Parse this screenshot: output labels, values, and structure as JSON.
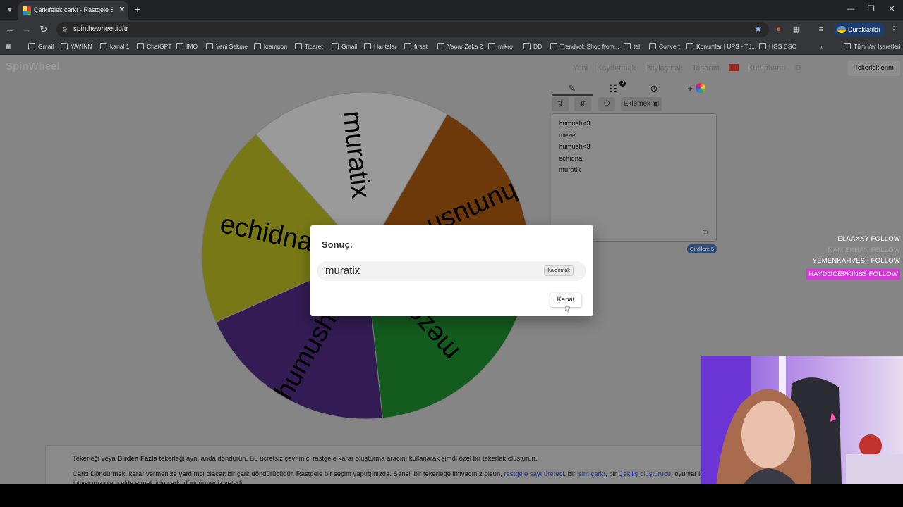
{
  "browser": {
    "tab_title": "Çarkıfelek çarkı - Rastgele Seçe",
    "url": "spinthewheel.io/tr",
    "profile_label": "Duraklatıldı",
    "bookmarks": [
      "Gmail",
      "YAYINN",
      "kanal 1",
      "ChatGPT",
      "IMO",
      "Yeni Sekme",
      "krampon",
      "Ticaret",
      "Gmail",
      "Haritalar",
      "fırsat",
      "Yapar Zeka 2",
      "mikro",
      "DD",
      "Trendyol: Shop from...",
      "tel",
      "Convert",
      "Konumlar | UPS - Tü...",
      "HGS CSC"
    ],
    "all_bookmarks": "Tüm Yer İşaretleri"
  },
  "site": {
    "logo": "SpinWheel",
    "nav": [
      "Yeni",
      "Kaydetmek",
      "Paylaşmak",
      "Tasarım",
      "Kütüphane"
    ],
    "my_wheels": "Tekerleklerim"
  },
  "wheel": {
    "segments": [
      {
        "label": "humush<3",
        "color": "#a6560f"
      },
      {
        "label": "meze",
        "color": "#1e8a2e"
      },
      {
        "label": "humush<3",
        "color": "#4b2a7d"
      },
      {
        "label": "echidna",
        "color": "#b6b821"
      },
      {
        "label": "muratix",
        "color": "#e9e9e9"
      }
    ]
  },
  "editor": {
    "add_label": "Eklemek",
    "badge_count": "0",
    "entries": [
      "humush<3",
      "meze",
      "humush<3",
      "echidna",
      "muratix"
    ],
    "count_label": "Girdileri: 5"
  },
  "stream_overlay": {
    "follows": [
      "ELAAXXY  FOLLOW",
      "NAMIEKHAN  FOLLOW",
      "YEMENKAHVESII  FOLLOW",
      "HAYDOCEPKINS3  FOLLOW"
    ]
  },
  "info": {
    "line1_pre": "Tekerleği veya ",
    "line1_bold": "Birden Fazla",
    "line1_post": " tekerleği aynı anda döndürün. Bu ücretsiz çevrimiçi rastgele karar oluşturma aracını kullanarak şimdi özel bir tekerlek oluşturun.",
    "line2_pre": "Çarkı Döndürmek, karar vermenize yardımcı olacak bir çark döndürücüdür. Rastgele bir seçim yaptığınızda. Şanslı bir tekerleğe ihtiyacınız olsun, ",
    "link1": "rastgele sayı üreteci",
    "line2_mid1": ", bir ",
    "link2": "isim çarkı",
    "line2_mid2": ", bir ",
    "link3": "Çekiliş oluşturucu",
    "line2_post": ", oyunlar için bir",
    "line3": "ihtiyacınız olanı elde etmek için çarkı döndürmeniz yeterli."
  },
  "dialog": {
    "title": "Sonuç:",
    "result": "muratix",
    "remove_label": "Kaldırmak",
    "close_label": "Kapat"
  }
}
